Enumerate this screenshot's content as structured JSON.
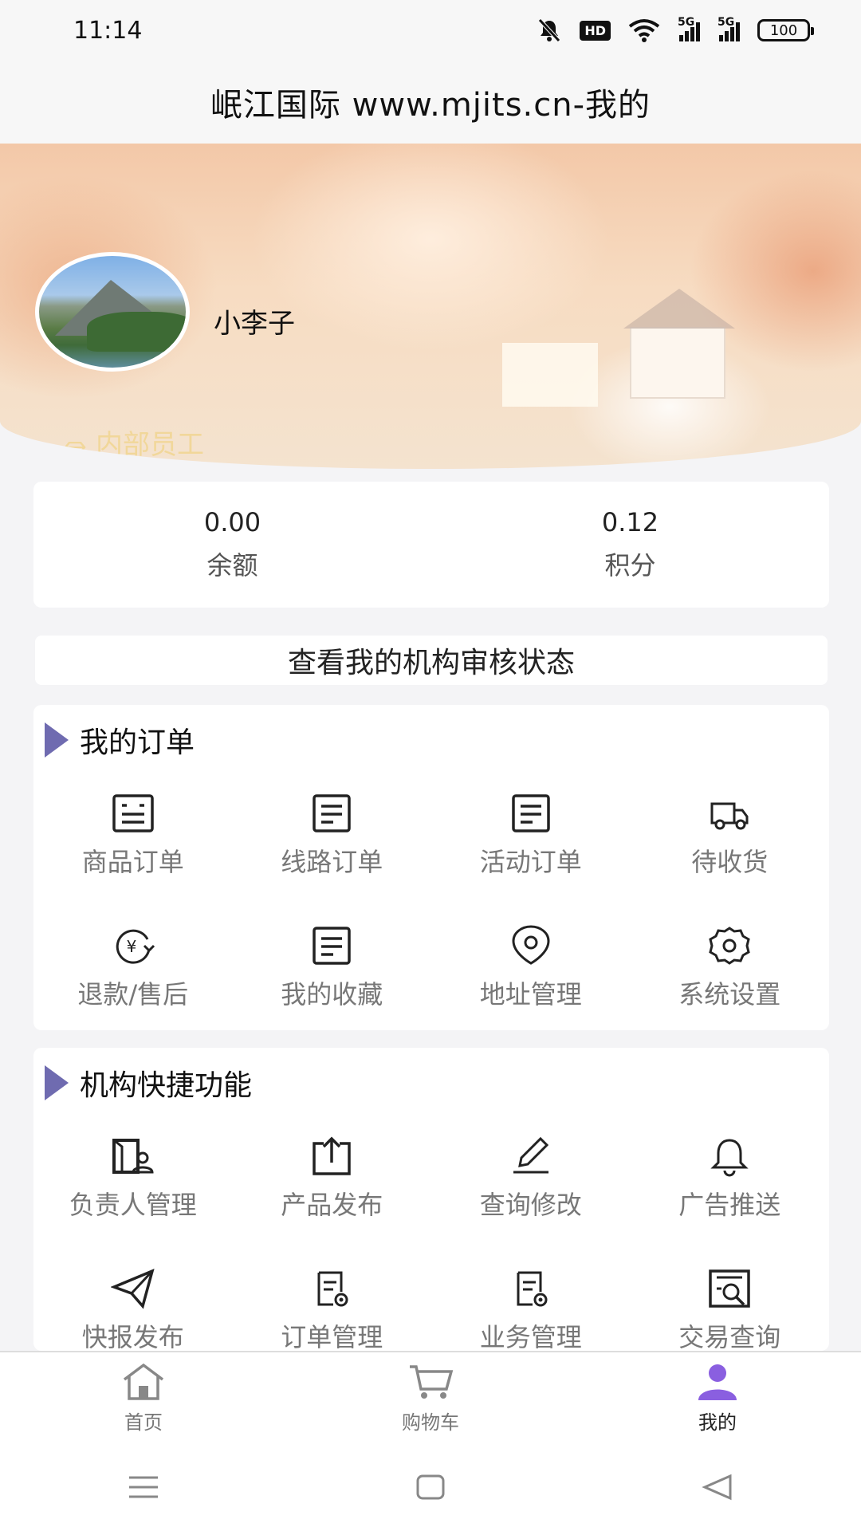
{
  "status": {
    "time": "11:14",
    "hd": "HD",
    "net1": "5G",
    "net2": "5G",
    "battery": "100"
  },
  "header": {
    "title": "岷江国际 www.mjits.cn-我的"
  },
  "profile": {
    "name": "小李子",
    "badge": "内部员工"
  },
  "balance": [
    {
      "value": "0.00",
      "label": "余额"
    },
    {
      "value": "0.12",
      "label": "积分"
    }
  ],
  "review": {
    "label": "查看我的机构审核状态"
  },
  "orders": {
    "title": "我的订单",
    "items": [
      {
        "label": "商品订单",
        "icon": "product-order-icon"
      },
      {
        "label": "线路订单",
        "icon": "route-order-icon"
      },
      {
        "label": "活动订单",
        "icon": "activity-order-icon"
      },
      {
        "label": "待收货",
        "icon": "truck-icon"
      },
      {
        "label": "退款/售后",
        "icon": "refund-icon"
      },
      {
        "label": "我的收藏",
        "icon": "favorites-icon"
      },
      {
        "label": "地址管理",
        "icon": "location-icon"
      },
      {
        "label": "系统设置",
        "icon": "gear-icon"
      }
    ]
  },
  "org": {
    "title": "机构快捷功能",
    "items": [
      {
        "label": "负责人管理",
        "icon": "manager-icon"
      },
      {
        "label": "产品发布",
        "icon": "upload-icon"
      },
      {
        "label": "查询修改",
        "icon": "edit-icon"
      },
      {
        "label": "广告推送",
        "icon": "bell-icon"
      },
      {
        "label": "快报发布",
        "icon": "send-icon"
      },
      {
        "label": "订单管理",
        "icon": "order-manage-icon"
      },
      {
        "label": "业务管理",
        "icon": "business-manage-icon"
      },
      {
        "label": "交易查询",
        "icon": "search-doc-icon"
      }
    ]
  },
  "nav": [
    {
      "label": "首页",
      "icon": "home-icon"
    },
    {
      "label": "购物车",
      "icon": "cart-icon"
    },
    {
      "label": "我的",
      "icon": "user-icon",
      "active": true
    }
  ],
  "colors": {
    "accent": "#6f6bb0",
    "active_nav": "#8a5fe0",
    "badge": "#f1d79a"
  }
}
